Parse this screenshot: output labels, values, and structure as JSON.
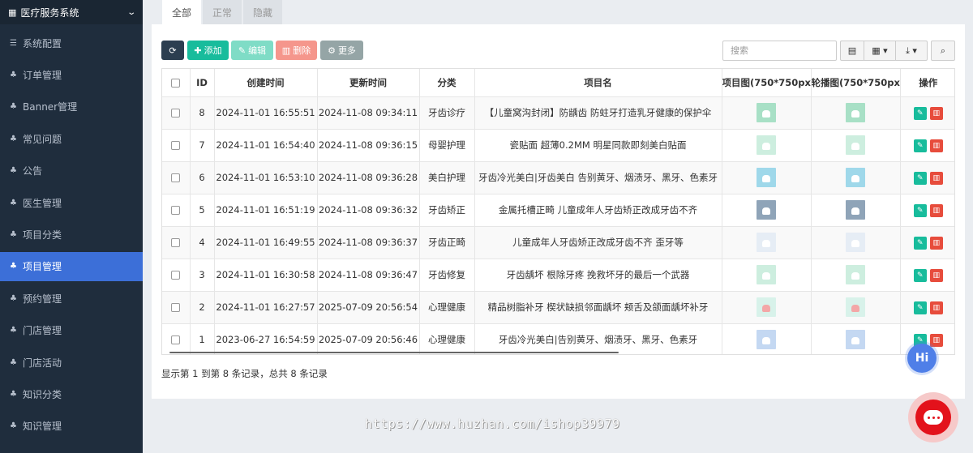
{
  "sidebar": {
    "title": "医疗服务系统",
    "items": [
      {
        "label": "系统配置",
        "icon": "sliders-icon"
      },
      {
        "label": "订单管理",
        "icon": "sitemap-icon"
      },
      {
        "label": "Banner管理",
        "icon": "sitemap-icon"
      },
      {
        "label": "常见问题",
        "icon": "sitemap-icon"
      },
      {
        "label": "公告",
        "icon": "sitemap-icon"
      },
      {
        "label": "医生管理",
        "icon": "sitemap-icon"
      },
      {
        "label": "项目分类",
        "icon": "sitemap-icon"
      },
      {
        "label": "项目管理",
        "icon": "sitemap-icon",
        "active": true
      },
      {
        "label": "预约管理",
        "icon": "sitemap-icon"
      },
      {
        "label": "门店管理",
        "icon": "sitemap-icon"
      },
      {
        "label": "门店活动",
        "icon": "sitemap-icon"
      },
      {
        "label": "知识分类",
        "icon": "sitemap-icon"
      },
      {
        "label": "知识管理",
        "icon": "sitemap-icon"
      }
    ]
  },
  "tabs": [
    "全部",
    "正常",
    "隐藏"
  ],
  "toolbar": {
    "add_label": "添加",
    "edit_label": "编辑",
    "delete_label": "删除",
    "more_label": "更多",
    "search_placeholder": "搜索"
  },
  "table": {
    "columns": [
      "ID",
      "创建时间",
      "更新时间",
      "分类",
      "项目名",
      "项目图(750*750px)",
      "轮播图(750*750px)",
      "操作"
    ],
    "rows": [
      {
        "id": "8",
        "created": "2024-11-01 16:55:51",
        "updated": "2024-11-08 09:34:11",
        "category": "牙齿诊疗",
        "name": "【儿童窝沟封闭】防龋齿 防蛀牙打造乳牙健康的保护伞",
        "img": "t-green"
      },
      {
        "id": "7",
        "created": "2024-11-01 16:54:40",
        "updated": "2024-11-08 09:36:15",
        "category": "母婴护理",
        "name": "瓷贴面 超薄0.2MM 明星同款即刻美白贴面",
        "img": "t-mint"
      },
      {
        "id": "6",
        "created": "2024-11-01 16:53:10",
        "updated": "2024-11-08 09:36:28",
        "category": "美白护理",
        "name": "牙齿冷光美白|牙齿美白 告别黄牙、烟渍牙、黑牙、色素牙",
        "img": "t-sky"
      },
      {
        "id": "5",
        "created": "2024-11-01 16:51:19",
        "updated": "2024-11-08 09:36:32",
        "category": "牙齿矫正",
        "name": "金属托槽正畸 儿童成年人牙齿矫正改成牙齿不齐",
        "img": "t-grey"
      },
      {
        "id": "4",
        "created": "2024-11-01 16:49:55",
        "updated": "2024-11-08 09:36:37",
        "category": "牙齿正畸",
        "name": "儿童成年人牙齿矫正改成牙齿不齐 歪牙等",
        "img": "t-paper"
      },
      {
        "id": "3",
        "created": "2024-11-01 16:30:58",
        "updated": "2024-11-08 09:36:47",
        "category": "牙齿修复",
        "name": "牙齿龋坏 根除牙疼 挽救坏牙的最后一个武器",
        "img": "t-mint"
      },
      {
        "id": "2",
        "created": "2024-11-01 16:27:57",
        "updated": "2025-07-09 20:56:54",
        "category": "心理健康",
        "name": "精品树脂补牙 楔状缺损邻面龋坏 颊舌及颌面龋坏补牙",
        "img": "t-pink"
      },
      {
        "id": "1",
        "created": "2023-06-27 16:54:59",
        "updated": "2025-07-09 20:56:46",
        "category": "心理健康",
        "name": "牙齿冷光美白|告别黄牙、烟渍牙、黑牙、色素牙",
        "img": "t-blue"
      }
    ]
  },
  "summary": "显示第 1 到第 8 条记录，总共 8 条记录",
  "float_hi": "Hi",
  "watermark": "https://www.huzhan.com/ishop39979"
}
